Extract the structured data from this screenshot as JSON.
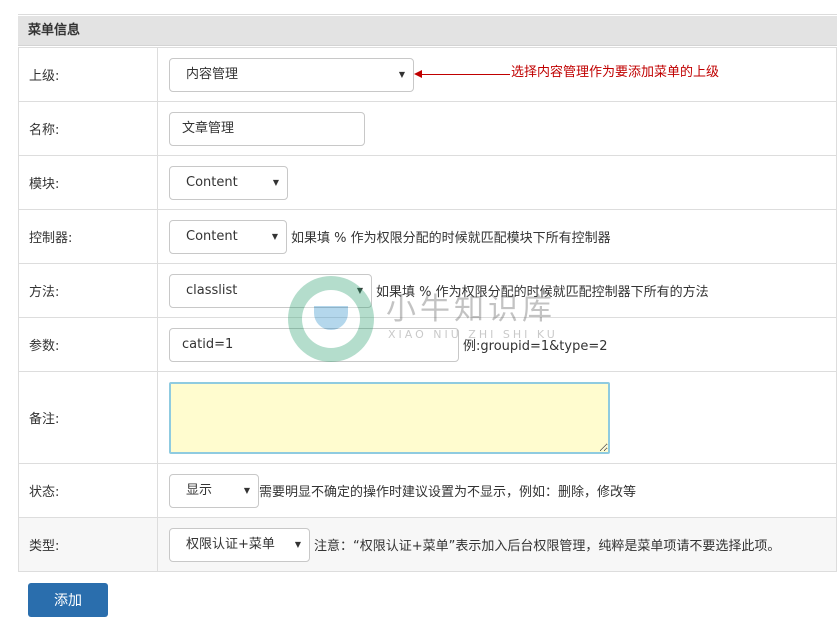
{
  "panel": {
    "title": "菜单信息"
  },
  "fields": {
    "parent": {
      "label": "上级:",
      "value": "内容管理"
    },
    "name": {
      "label": "名称:",
      "value": "文章管理"
    },
    "module": {
      "label": "模块:",
      "value": "Content"
    },
    "controller": {
      "label": "控制器:",
      "value": "Content",
      "hint": "如果填 % 作为权限分配的时候就匹配模块下所有控制器"
    },
    "method": {
      "label": "方法:",
      "value": "classlist",
      "hint": "如果填 % 作为权限分配的时候就匹配控制器下所有的方法"
    },
    "params": {
      "label": "参数:",
      "value": "catid=1",
      "hint": "例:groupid=1&type=2"
    },
    "remark": {
      "label": "备注:",
      "value": ""
    },
    "status": {
      "label": "状态:",
      "value": "显示",
      "hint": "需要明显不确定的操作时建议设置为不显示，例如：删除，修改等"
    },
    "type": {
      "label": "类型:",
      "value": "权限认证+菜单",
      "hint": "注意：“权限认证+菜单”表示加入后台权限管理，纯粹是菜单项请不要选择此项。"
    }
  },
  "annotation": {
    "text": "选择内容管理作为要添加菜单的上级",
    "color": "#c00000"
  },
  "submit": {
    "label": "添加"
  },
  "watermark": {
    "cn": "小牛知识库",
    "en": "XIAO NIU ZHI SHI KU"
  },
  "colors": {
    "button": "#2a6ead",
    "textarea_bg": "#fffccf",
    "textarea_border": "#8fcbe0",
    "header_bg": "#e3e3e3"
  },
  "icons": {
    "dropdown": "caret-down-icon"
  }
}
